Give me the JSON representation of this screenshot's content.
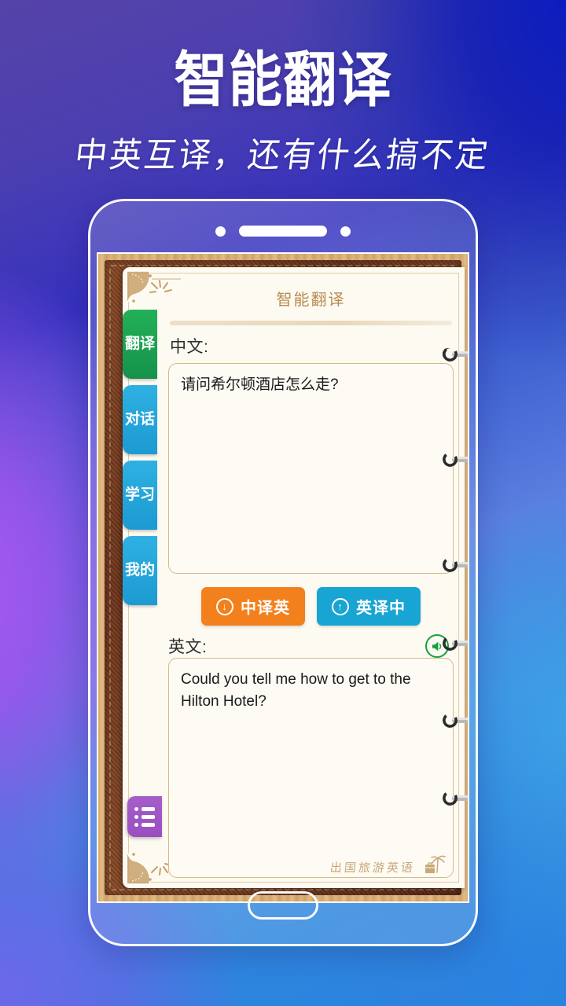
{
  "poster": {
    "title": "智能翻译",
    "subtitle": "中英互译，还有什么搞不定"
  },
  "colors": {
    "bg_top_left": "#5543A8",
    "bg_top_right": "#1220B4",
    "bg_mid_left": "#9B55EC",
    "bg_bottom_left": "#6566E5",
    "bg_bottom_right": "#2B82DE",
    "tab_active": "#1CA94E",
    "tab_inactive": "#29A8DC",
    "button_cn_to_en": "#F2811D",
    "button_en_to_cn": "#18A5D4",
    "speaker_green": "#14A03E",
    "list_button_purple": "#9A4FC1",
    "app_title_brown": "#B98B50",
    "paper": "#FDFAF2"
  },
  "phone": {
    "camera_icon": "camera-dot",
    "speaker_icon": "earpiece-speaker",
    "home_button": "home-button"
  },
  "app": {
    "title": "智能翻译",
    "tabs": [
      {
        "label": "翻译",
        "active": true,
        "name": "tab-translate"
      },
      {
        "label": "对话",
        "active": false,
        "name": "tab-conversation"
      },
      {
        "label": "学习",
        "active": false,
        "name": "tab-study"
      },
      {
        "label": "我的",
        "active": false,
        "name": "tab-mine"
      }
    ],
    "chinese": {
      "label": "中文:",
      "value": "请问希尔顿酒店怎么走?"
    },
    "english": {
      "label": "英文:",
      "value": "Could you tell me how to get to the Hilton Hotel?"
    },
    "buttons": [
      {
        "label": "中译英",
        "icon": "arrow-down-circle-icon",
        "style": "orange"
      },
      {
        "label": "英译中",
        "icon": "arrow-up-circle-icon",
        "style": "blue"
      }
    ],
    "speaker_icon": "speaker-icon",
    "list_menu_icon": "list-menu-icon",
    "brand": {
      "text": "出国旅游英语",
      "icons": [
        "palm-tree-icon",
        "suitcase-icon"
      ]
    },
    "binder_rings": 6
  }
}
